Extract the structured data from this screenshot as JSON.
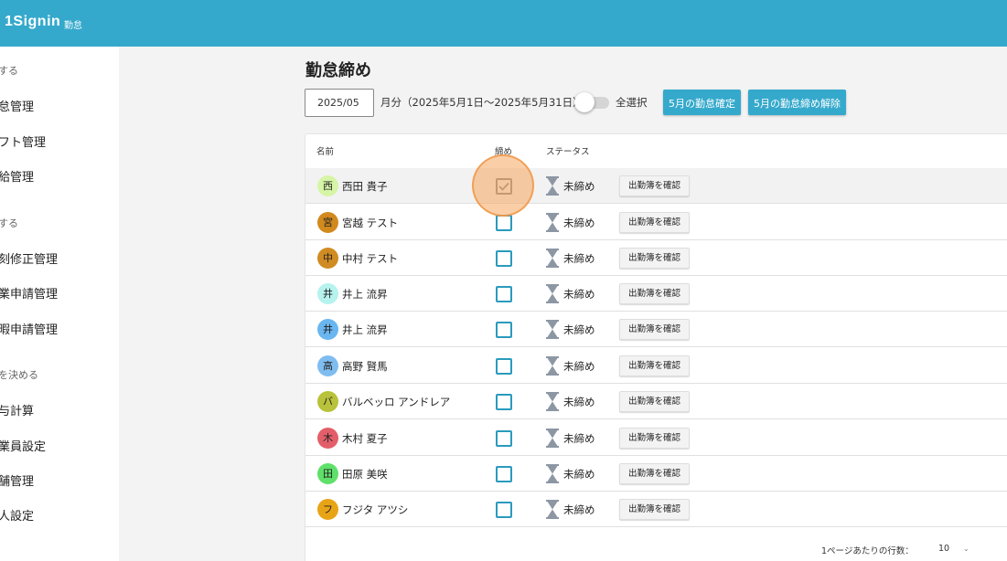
{
  "header": {
    "brand": "1Signin",
    "brand_sub": "勤怠"
  },
  "sidebar": {
    "sections": [
      {
        "label": "する",
        "items": [
          "怠管理",
          "フト管理",
          "給管理"
        ]
      },
      {
        "label": "する",
        "items": [
          "刻修正管理",
          "業申請管理",
          "暇申請管理"
        ]
      },
      {
        "label": "を決める",
        "items": [
          "与計算",
          "業員設定",
          "舗管理",
          "人設定"
        ]
      }
    ]
  },
  "page": {
    "title": "勤怠締め"
  },
  "toolbar": {
    "month_value": "2025/05",
    "period_label": "月分（2025年5月1日〜2025年5月31日）",
    "select_all_label": "全選択",
    "confirm_button": "5月の勤怠確定",
    "release_button": "5月の勤怠締め解除"
  },
  "table": {
    "columns": {
      "name": "名前",
      "close": "締め",
      "status": "ステータス"
    },
    "confirm_button_label": "出勤簿を確認",
    "rows": [
      {
        "initial": "西",
        "name": "西田 貴子",
        "status": "未締め",
        "checked": true,
        "avatar_color": "#d6f5a6"
      },
      {
        "initial": "宮",
        "name": "宮越 テスト",
        "status": "未締め",
        "checked": false,
        "avatar_color": "#d28a1e"
      },
      {
        "initial": "中",
        "name": "中村 テスト",
        "status": "未締め",
        "checked": false,
        "avatar_color": "#d08b22"
      },
      {
        "initial": "井",
        "name": "井上 流昇",
        "status": "未締め",
        "checked": false,
        "avatar_color": "#b6f2ee"
      },
      {
        "initial": "井",
        "name": "井上 流昇",
        "status": "未締め",
        "checked": false,
        "avatar_color": "#6ab6f0"
      },
      {
        "initial": "高",
        "name": "高野 賢馬",
        "status": "未締め",
        "checked": false,
        "avatar_color": "#7fbdf0"
      },
      {
        "initial": "バ",
        "name": "バルベッロ アンドレア",
        "status": "未締め",
        "checked": false,
        "avatar_color": "#b8c23a"
      },
      {
        "initial": "木",
        "name": "木村 夏子",
        "status": "未締め",
        "checked": false,
        "avatar_color": "#e25f6a"
      },
      {
        "initial": "田",
        "name": "田原 美咲",
        "status": "未締め",
        "checked": false,
        "avatar_color": "#5fe06a"
      },
      {
        "initial": "フ",
        "name": "フジタ アツシ",
        "status": "未締め",
        "checked": false,
        "avatar_color": "#e8a417"
      }
    ]
  },
  "pagination": {
    "rows_per_page_label": "1ページあたりの行数：",
    "rows_per_page_value": "10"
  },
  "colors": {
    "accent": "#35a9cc",
    "checkbox_border": "#2a9bbd",
    "click_indicator": "#f6a860"
  }
}
